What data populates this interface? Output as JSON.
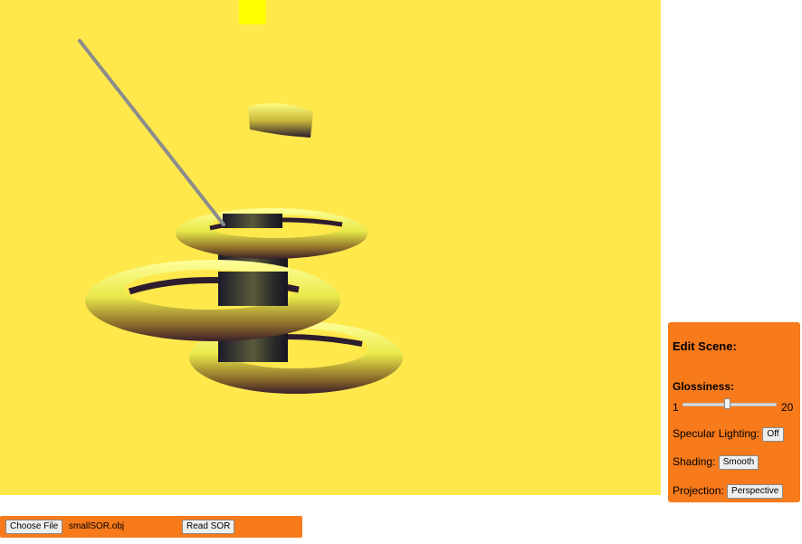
{
  "edit_panel": {
    "title": "Edit Scene:",
    "glossiness_label": "Glossiness:",
    "glossiness_min": "1",
    "glossiness_max": "20",
    "glossiness_value": 10,
    "specular_label": "Specular Lighting:",
    "specular_button": "Off",
    "shading_label": "Shading:",
    "shading_button": "Smooth",
    "projection_label": "Projection:",
    "projection_button": "Perspective"
  },
  "file_bar": {
    "choose_button": "Choose File",
    "file_name": "smallSOR.obj",
    "read_button": "Read SOR"
  },
  "colors": {
    "background": "#ffe84c",
    "panel": "#f77a1b",
    "light_marker": "#ffff00",
    "object_yellow": "#f3f35a"
  }
}
